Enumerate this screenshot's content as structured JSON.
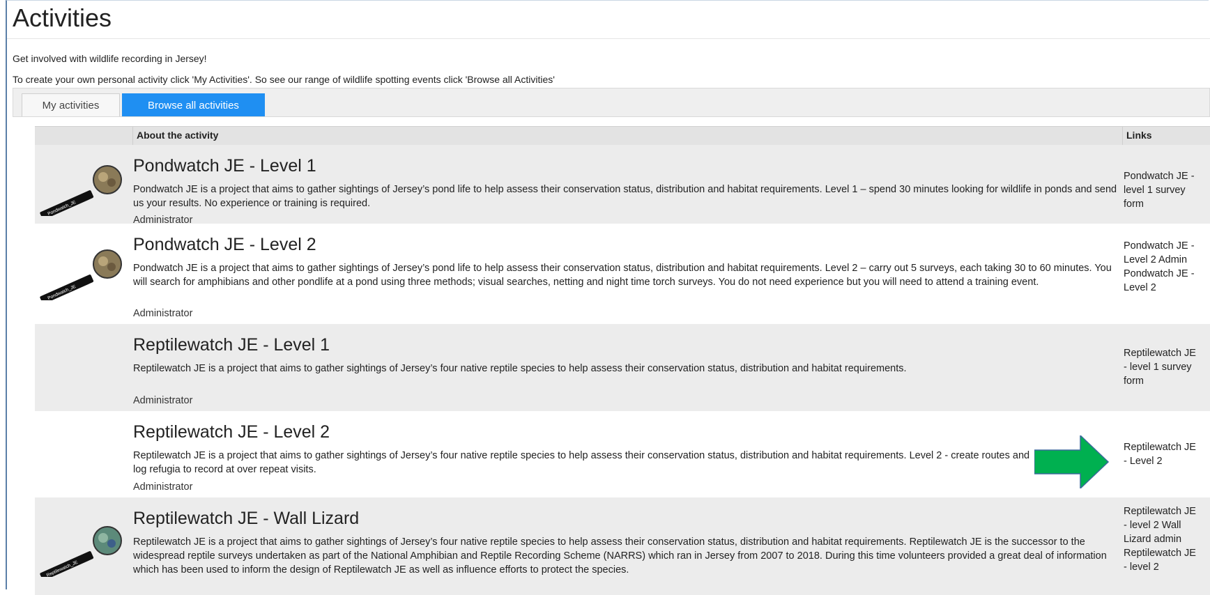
{
  "page": {
    "title": "Activities",
    "intro_line1": "Get involved with wildlife recording in Jersey!",
    "intro_line2": "To create your own personal activity click 'My Activities'. So see our range of wildlife spotting events click 'Browse all Activities'"
  },
  "tabs": [
    {
      "label": "My activities",
      "active": false
    },
    {
      "label": "Browse all activities",
      "active": true
    }
  ],
  "table": {
    "header_about": "About the activity",
    "header_links": "Links"
  },
  "activities": [
    {
      "title": "Pondwatch JE - Level 1",
      "description": "Pondwatch JE is a project that aims to gather sightings of Jersey’s pond life to help assess their conservation status, distribution and habitat requirements. Level 1 – spend 30 minutes looking for wildlife in ponds and send us your results. No experience or training is required.",
      "owner": "Administrator",
      "links": [
        "Pondwatch JE - level 1 survey form"
      ],
      "thumbnail_label": "Pondwatch_JE"
    },
    {
      "title": "Pondwatch JE - Level 2",
      "description": "Pondwatch JE is a project that aims to gather sightings of Jersey’s pond life to help assess their conservation status, distribution and habitat requirements. Level 2 – carry out 5 surveys, each taking 30 to 60 minutes. You will search for amphibians and other pondlife at a pond using three methods; visual searches, netting and night time torch surveys. You do not need experience but you will need to attend a training event.",
      "owner": "Administrator",
      "links": [
        "Pondwatch JE - Level 2 Admin",
        "Pondwatch JE - Level 2"
      ],
      "thumbnail_label": "Pondwatch_JE"
    },
    {
      "title": "Reptilewatch JE - Level 1",
      "description": "Reptilewatch JE is a project that aims to gather sightings of Jersey’s four native reptile species to help assess their conservation status, distribution and habitat requirements.",
      "owner": "Administrator",
      "links": [
        "Reptilewatch JE - level 1 survey form"
      ],
      "thumbnail_label": ""
    },
    {
      "title": "Reptilewatch JE - Level 2",
      "description": "Reptilewatch JE is a project that aims to gather sightings of Jersey’s four native reptile species to help assess their conservation status, distribution and habitat requirements. Level 2 - create routes and log refugia to record at over repeat visits.",
      "owner": "Administrator",
      "links": [
        "Reptilewatch JE - Level 2"
      ],
      "thumbnail_label": ""
    },
    {
      "title": "Reptilewatch JE - Wall Lizard",
      "description": "Reptilewatch JE is a project that aims to gather sightings of Jersey’s four native reptile species to help assess their conservation status, distribution and habitat requirements. Reptilewatch JE is the successor to the widespread reptile surveys undertaken as part of the National Amphibian and Reptile Recording Scheme (NARRS) which ran in Jersey from 2007 to 2018. During this time volunteers provided a great deal of information which has been used to inform the design of Reptilewatch JE as well as influence efforts to protect the species.",
      "owner": "",
      "links": [
        "Reptilewatch JE - level 2 Wall Lizard admin",
        "Reptilewatch JE - level 2"
      ],
      "thumbnail_label": "Reptilewatch_JE"
    }
  ],
  "colors": {
    "tab_active": "#1f8ff2",
    "arrow": "#00b050",
    "row_alt": "#ececec"
  }
}
